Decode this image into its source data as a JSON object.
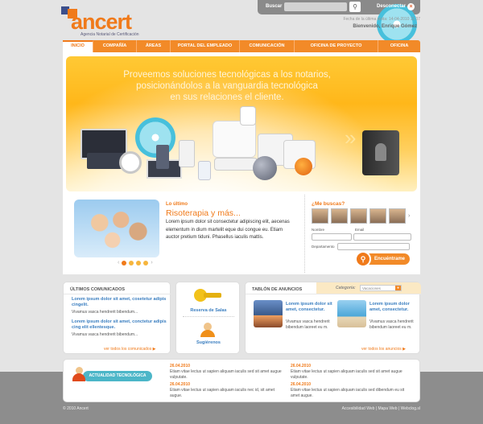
{
  "logo": {
    "name": "ancert",
    "tagline": "Agencia Notarial de Certificación"
  },
  "topbar": {
    "search_label": "Buscar",
    "search_placeholder": "",
    "disconnect": "Desconectar"
  },
  "session": {
    "last_access": "Fecha de la última visita: 14-04-2010 11:37",
    "welcome": "Bienvenido, Enrique Gómez"
  },
  "nav": [
    "INICIO",
    "COMPAÑÍA",
    "ÁREAS",
    "PORTAL DEL EMPLEADO",
    "COMUNICACIÓN",
    "OFICINA DE PROYECTO",
    "OFICINA"
  ],
  "hero": {
    "line1": "Proveemos soluciones tecnológicas a los notarios,",
    "line2": "posicionándolos a la vanguardia tecnológica",
    "line3": "en sus relaciones el cliente."
  },
  "latest": {
    "kicker": "Lo último",
    "title": "Risoterapia y más...",
    "body": "Lorem ipsum dolor sit consectetur adipiscing elit, aecenas elementum in dium martelit eque dui congue eu. Etiam auctor pretium tiduni. Phasellus iaculis mattis.",
    "slider_count": 4
  },
  "people": {
    "heading": "¿Me buscas?",
    "name_label": "Nombre",
    "email_label": "Email",
    "dept_label": "Departamento",
    "button": "Encuéntrame"
  },
  "comunicados": {
    "heading": "ÚLTIMOS COMUNICADOS",
    "items": [
      {
        "title": "Lorem ipsum dolor sit amet, cosetetur adipis cingelit.",
        "desc": "Vivamus vasca hendrerit bibendum..."
      },
      {
        "title": "Lorem ipsum dolor sit amet, conctetur adipis cing elit ellentesque.",
        "desc": "Vivamus vasca hendrerit bibendum..."
      }
    ],
    "more": "ver todos los comunicados"
  },
  "services": {
    "item1": "Reserva de Salas",
    "item2": "Sugiérenos"
  },
  "board": {
    "heading": "TABLÓN DE ANUNCIOS",
    "category_label": "Categoría:",
    "category_value": "Vacaciones",
    "items": [
      {
        "title": "Lorem ipsum dolor sit amet, consectetur.",
        "desc": "Vivamus vasca hendrerit bibendum laoreet eu m."
      },
      {
        "title": "Lorem ipsum dolor amet, consectetur.",
        "desc": "Vivamus vasca hendrerit bibendum laoreet eu m."
      }
    ],
    "more": "ver todos los anuncios"
  },
  "tech": {
    "label": "ACTUALIDAD TECNOLÓGICA",
    "col1": [
      {
        "date": "26.04.2010",
        "text": "Etiam vitae lectus ut sapien aliquam iaculis sed sit amet augue vulputate."
      },
      {
        "date": "26.04.2010",
        "text": "Etiam vitae lectus ut sapien aliquam iaculis nec id, sit amet augue."
      }
    ],
    "col2": [
      {
        "date": "26.04.2010",
        "text": "Etiam vitae lectus ut sapien aliquam iaculis sed sit amet augue vulputate."
      },
      {
        "date": "26.04.2010",
        "text": "Etiam vitae lectus ut sapien aliquam iaculis sed dibendum eu sit amet augue."
      }
    ]
  },
  "footer": {
    "copyright": "© 2010 Ancert",
    "links": "Accesibilidad Web | Mapa Web | Webclog.sl"
  },
  "colors": {
    "accent": "#f07a1a",
    "link": "#3a7ec0",
    "teal": "#4cb6c8"
  },
  "icons": [
    "search-icon",
    "close-icon",
    "user-icon",
    "key-icon",
    "chevron-right-icon"
  ]
}
